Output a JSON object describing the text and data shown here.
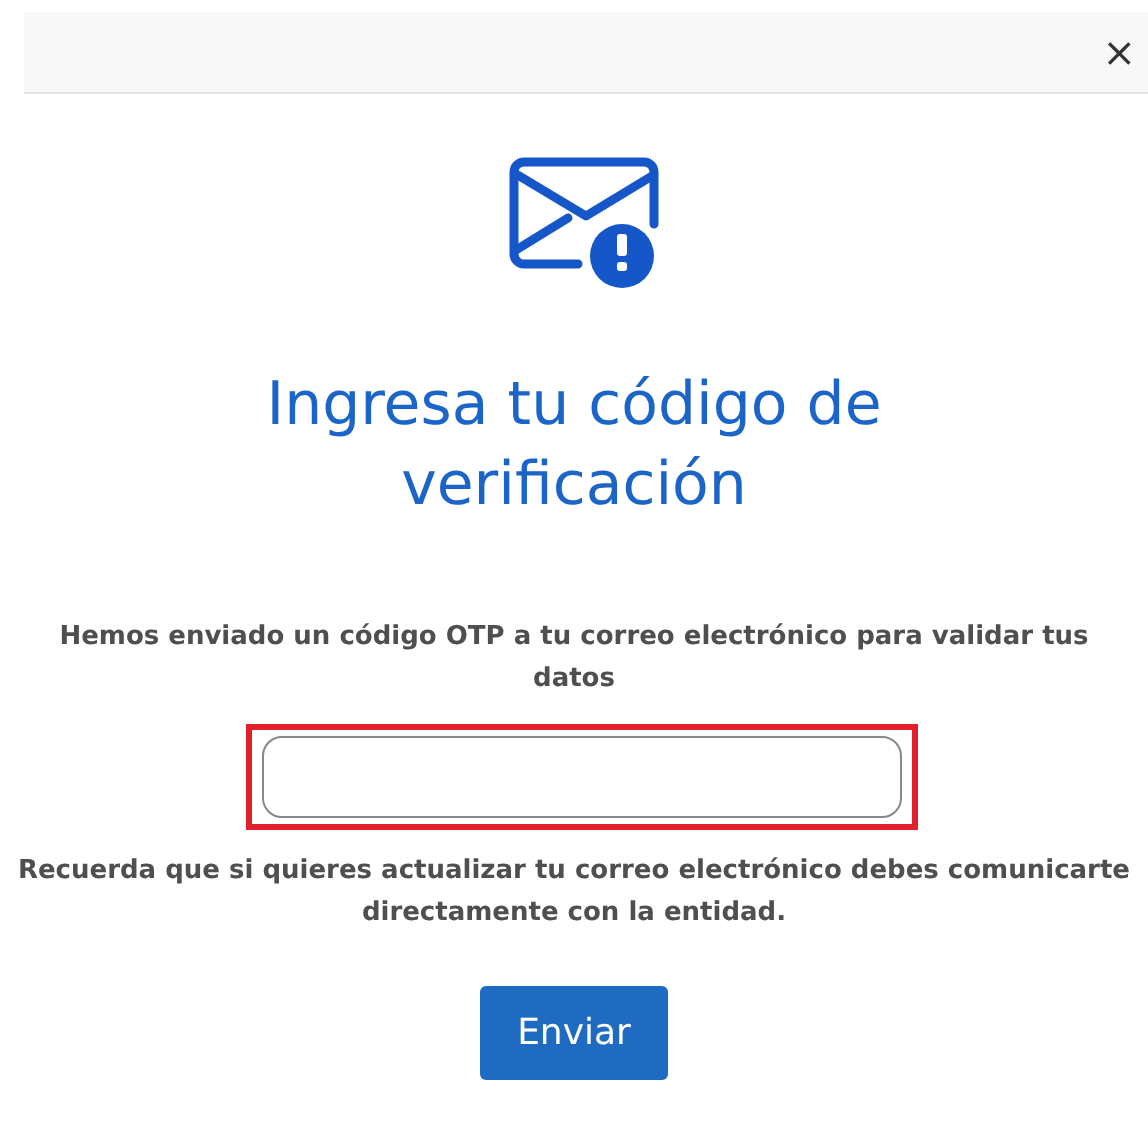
{
  "dialog": {
    "close": "×"
  },
  "title": "Ingresa tu código de verificación",
  "message": "Hemos enviado un código OTP a tu correo electrónico para validar tus datos",
  "code_field": {
    "highlighted": true
  },
  "note": "Recuerda que si quieres actualizar tu correo electrónico debes comunicarte directamente con la entidad.",
  "submit": "Enviar"
}
